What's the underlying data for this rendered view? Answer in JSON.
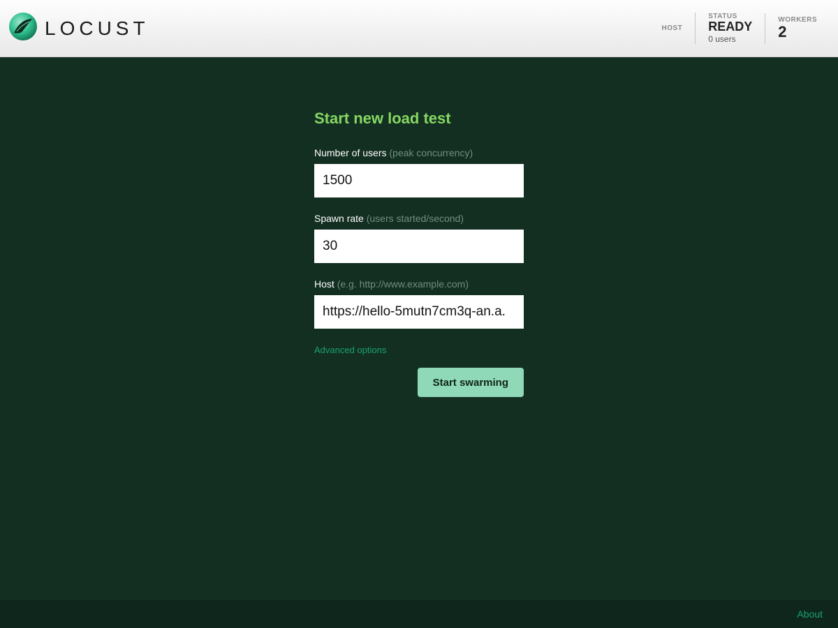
{
  "header": {
    "brand": "LOCUST",
    "host_label": "HOST",
    "status_label": "STATUS",
    "status_value": "READY",
    "status_sub": "0 users",
    "workers_label": "WORKERS",
    "workers_value": "2"
  },
  "form": {
    "title": "Start new load test",
    "users_label": "Number of users",
    "users_hint": "(peak concurrency)",
    "users_value": "1500",
    "spawn_label": "Spawn rate",
    "spawn_hint": "(users started/second)",
    "spawn_value": "30",
    "host_label": "Host",
    "host_hint": "(e.g. http://www.example.com)",
    "host_value": "https://hello-5mutn7cm3q-an.a.",
    "advanced": "Advanced options",
    "submit": "Start swarming"
  },
  "footer": {
    "about": "About"
  }
}
